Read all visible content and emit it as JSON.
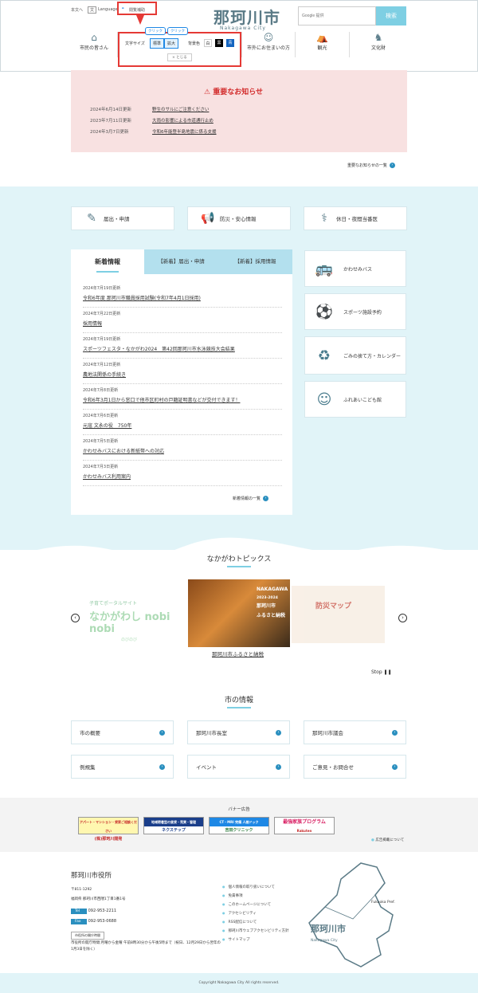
{
  "header": {
    "text_only": "本文へ",
    "language": "Language",
    "reading_aid": "閲覧補助",
    "logo": "那珂川市",
    "logo_sub": "Nakagawa City",
    "search_placeholder": "Google 提供",
    "search_button": "検索",
    "nav": [
      {
        "label": "市民の皆さん",
        "icon": "house-icon"
      },
      {
        "label": "市外にお住まいの方",
        "icon": "people-icon"
      },
      {
        "label": "観光",
        "icon": "tent-icon"
      },
      {
        "label": "文化財",
        "icon": "deer-icon"
      }
    ]
  },
  "accessibility": {
    "font_size_label": "文字サイズ",
    "standard": "標準",
    "enlarge": "拡大",
    "bg_color_label": "背景色",
    "white": "白",
    "black": "黒",
    "blue": "青",
    "close": "× とじる",
    "click1": "クリック",
    "click2": "クリック"
  },
  "notice": {
    "title": "重要なお知らせ",
    "items": [
      {
        "date": "2024年6月14日更新",
        "text": "野生のサルにご注意ください"
      },
      {
        "date": "2023年7月11日更新",
        "text": "大雨の影響による市道通行止め"
      },
      {
        "date": "2024年3月7日更新",
        "text": "令和6年能登半島地震に係る支援"
      }
    ],
    "more": "重要なお知らせの一覧"
  },
  "quick": [
    {
      "label": "届出・申請",
      "icon": "form-icon"
    },
    {
      "label": "防災・安心情報",
      "icon": "megaphone-icon"
    },
    {
      "label": "休日・夜間当番医",
      "icon": "stethoscope-icon"
    }
  ],
  "news": {
    "tabs": [
      "新着情報",
      "【新着】届出・申請",
      "【新着】採用情報"
    ],
    "items": [
      {
        "date": "2024年7月19日更新",
        "text": "令和6年度 那珂川市職員採用試験(令和7年4月1日採用)"
      },
      {
        "date": "2024年7月22日更新",
        "text": "採用情報"
      },
      {
        "date": "2024年7月19日更新",
        "text": "スポーツフェスタ・なかがわ2024　第42回那珂川市水泳競技大会結果"
      },
      {
        "date": "2024年7月12日更新",
        "text": "農地法関係の手続き"
      },
      {
        "date": "2024年7月8日更新",
        "text": "令和6年3月1日から窓口で他市区町村の戸籍証明書などが交付できます！"
      },
      {
        "date": "2024年7月6日更新",
        "text": "元寇 文永の役　750年"
      },
      {
        "date": "2024年7月5日更新",
        "text": "かわせみバスにおける新紙幣への対応"
      },
      {
        "date": "2024年7月3日更新",
        "text": "かわせみバス利用案内"
      }
    ],
    "more": "新着情報の一覧"
  },
  "side": [
    {
      "label": "かわせみバス",
      "icon": "bus-icon"
    },
    {
      "label": "スポーツ施設予約",
      "icon": "sports-icon"
    },
    {
      "label": "ごみの捨て方・カレンダー",
      "icon": "garbage-bag-icon"
    },
    {
      "label": "ふれあいこども館",
      "icon": "children-icon"
    }
  ],
  "topics": {
    "title": "なかがわトピックス",
    "slide_left": "なかがわし nobi nobi",
    "slide_left_sub": "子育てポータルサイト",
    "slide_left_tag": "のびのび",
    "slide_center_lines": [
      "NAKAGAWA",
      "那珂川市",
      "ふるさと納税"
    ],
    "slide_center_sub": "2023-2024",
    "caption": "那珂川市ふるさと納税",
    "stop": "Stop ❚❚",
    "slide_right": "防災マップ"
  },
  "city_info": {
    "title": "市の情報",
    "items": [
      "市の概要",
      "那珂川市長室",
      "那珂川市議会",
      "例規集",
      "イベント",
      "ご意見・お問合せ"
    ]
  },
  "banners": {
    "title": "バナー広告",
    "items": [
      {
        "text": "(株)那珂川開発",
        "top": "アパート・マンション・貸家ご相談ください"
      },
      {
        "text": "ネクステップ",
        "top": "地域密着型の賃貸・売買・管理"
      },
      {
        "text": "吉田クリニック",
        "top": "CT・MRI 完備 人間ドック"
      },
      {
        "text": "最強家族プログラム",
        "top": "Rakuten"
      }
    ],
    "about": "広告掲載について"
  },
  "footer": {
    "title": "那珂川市役所",
    "zip": "〒811-1292",
    "address": "福岡県 那珂川市西隈1丁目1番1号",
    "tel_label": "Tel",
    "tel": "092-953-2211",
    "fax_label": "Fax",
    "fax": "092-953-0688",
    "hours_title": "市役所の開庁時間",
    "hours": "市役所の開庁時間:月曜から金曜 午前8時30分から午後5時まで（祝日、12月29日から翌年の1月3日を除く）",
    "links": [
      "個人情報の取り扱いについて",
      "免責事項",
      "このホームページについて",
      "アクセシビリティ",
      "RSS配信について",
      "那珂川市ウェブアクセシビリティ方針",
      "サイトマップ"
    ],
    "map_label": "Fukuoka Pref.",
    "map_logo": "那珂川市",
    "map_logo_sub": "Nakagawa City",
    "copyright": "Copyright Nakagawa City All rights reserved."
  }
}
